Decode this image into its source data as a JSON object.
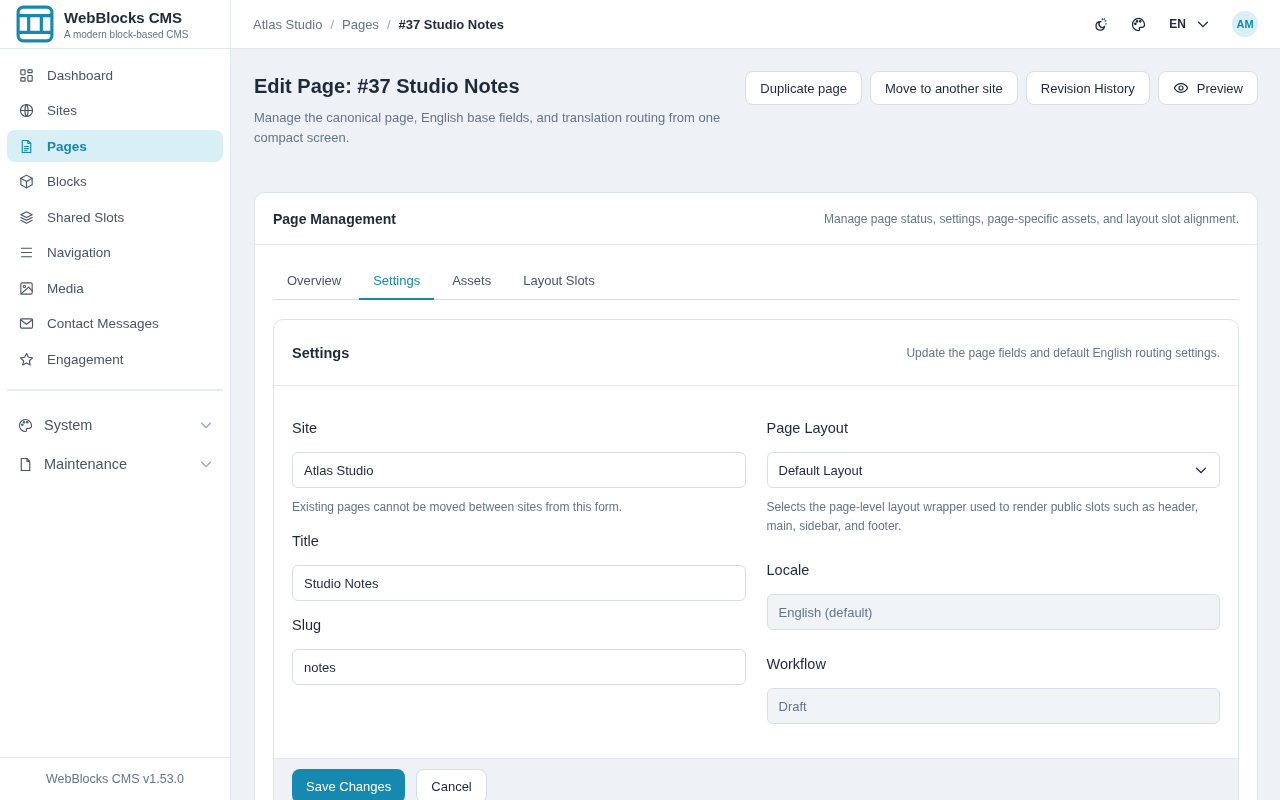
{
  "brand": {
    "name": "WebBlocks CMS",
    "tagline": "A modern block-based CMS"
  },
  "sidebar": {
    "items": [
      {
        "label": "Dashboard",
        "selected": false
      },
      {
        "label": "Sites",
        "selected": false
      },
      {
        "label": "Pages",
        "selected": true
      },
      {
        "label": "Blocks",
        "selected": false
      },
      {
        "label": "Shared Slots",
        "selected": false
      },
      {
        "label": "Navigation",
        "selected": false
      },
      {
        "label": "Media",
        "selected": false
      },
      {
        "label": "Contact Messages",
        "selected": false
      },
      {
        "label": "Engagement",
        "selected": false
      }
    ],
    "groups": [
      {
        "label": "System",
        "expanded": false
      },
      {
        "label": "Maintenance",
        "expanded": false
      }
    ],
    "version": "WebBlocks CMS v1.53.0"
  },
  "breadcrumbs": [
    {
      "label": "Atlas Studio",
      "current": false
    },
    {
      "label": "Pages",
      "current": false
    },
    {
      "label": "#37 Studio Notes",
      "current": true
    }
  ],
  "breadcrumb_separator": "/",
  "topbar": {
    "language": "EN",
    "avatar": "AM"
  },
  "page": {
    "title": "Edit Page: #37 Studio Notes",
    "subtitle": "Manage the canonical page, English base fields, and translation routing from one compact screen.",
    "actions": [
      {
        "label": "Duplicate page",
        "kind": "plain"
      },
      {
        "label": "Move to another site",
        "kind": "plain"
      },
      {
        "label": "Revision History",
        "kind": "plain"
      },
      {
        "label": "Preview",
        "kind": "preview"
      }
    ]
  },
  "management": {
    "title": "Page Management",
    "description": "Manage page status, settings, page-specific assets, and layout slot alignment.",
    "tabs": [
      {
        "label": "Overview",
        "selected": false
      },
      {
        "label": "Settings",
        "selected": true
      },
      {
        "label": "Assets",
        "selected": false
      },
      {
        "label": "Layout Slots",
        "selected": false
      }
    ]
  },
  "settings": {
    "title": "Settings",
    "description": "Update the page fields and default English routing settings.",
    "left_fields": [
      {
        "label": "Site",
        "value": "Atlas Studio",
        "kind": "text",
        "disabled": false,
        "help": "Existing pages cannot be moved between sites from this form."
      },
      {
        "label": "Title",
        "value": "Studio Notes",
        "kind": "text",
        "disabled": false
      },
      {
        "label": "Slug",
        "value": "notes",
        "kind": "text",
        "disabled": false
      }
    ],
    "right_fields": [
      {
        "label": "Page Layout",
        "value": "Default Layout",
        "kind": "select",
        "disabled": false,
        "help": "Selects the page-level layout wrapper used to render public slots such as header, main, sidebar, and footer."
      },
      {
        "label": "Locale",
        "value": "English (default)",
        "kind": "text",
        "disabled": true
      },
      {
        "label": "Workflow",
        "value": "Draft",
        "kind": "text",
        "disabled": true
      }
    ],
    "buttons": [
      {
        "label": "Save Changes",
        "kind": "primary"
      },
      {
        "label": "Cancel",
        "kind": "secondary"
      }
    ]
  }
}
